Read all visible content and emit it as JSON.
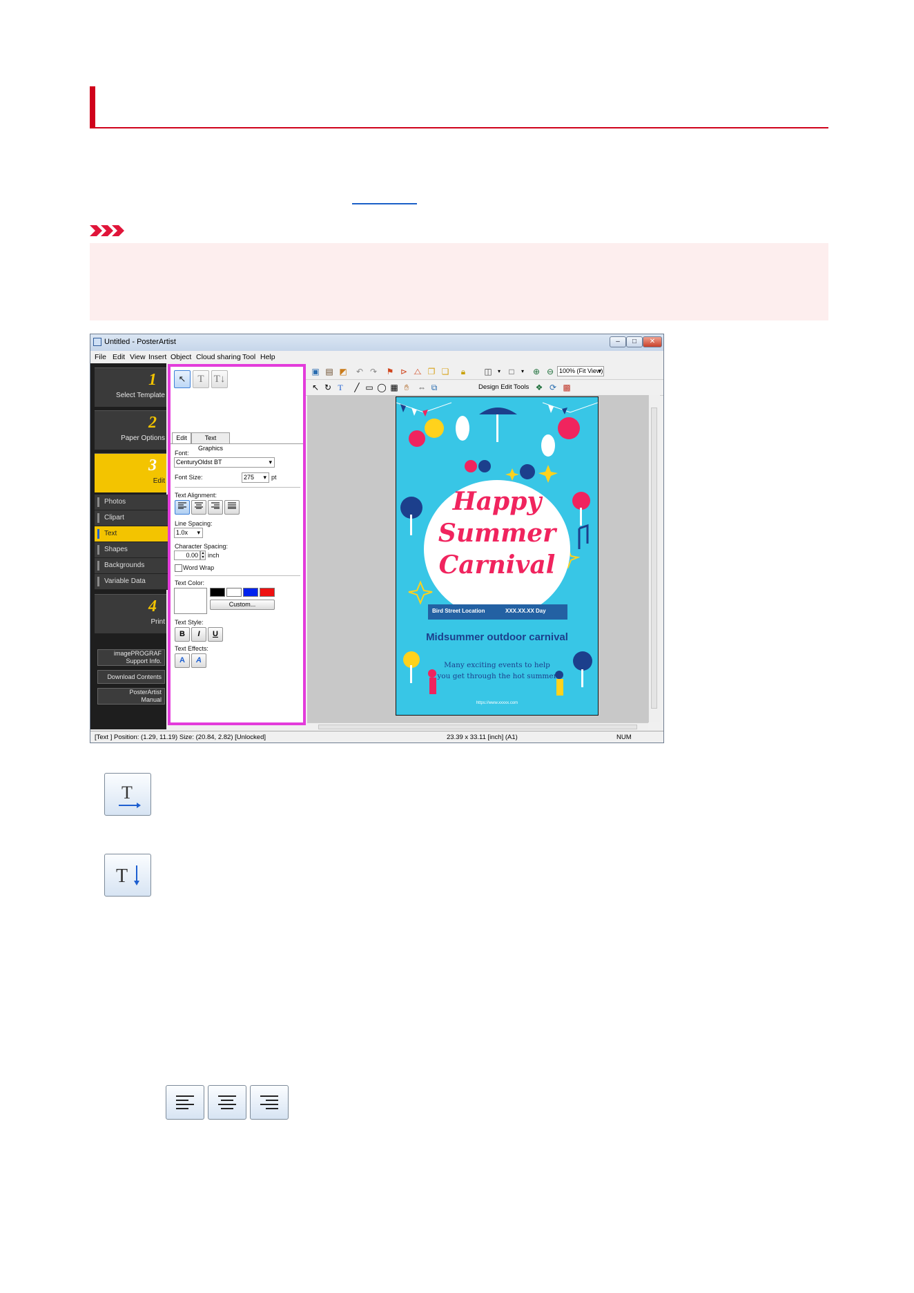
{
  "window": {
    "title": "Untitled - PosterArtist",
    "controls": [
      "–",
      "□",
      "✕"
    ]
  },
  "menu": [
    "File",
    "Edit",
    "View",
    "Insert",
    "Object",
    "Cloud sharing",
    "Tool",
    "Help"
  ],
  "steps": [
    {
      "num": "1",
      "label": "Select Template"
    },
    {
      "num": "2",
      "label": "Paper Options"
    },
    {
      "num": "3",
      "label": "Edit"
    },
    {
      "num": "4",
      "label": "Print"
    }
  ],
  "edit_sub_items": [
    "Photos",
    "Clipart",
    "Text",
    "Shapes",
    "Backgrounds",
    "Variable Data"
  ],
  "support_buttons": {
    "support_info_line1": "imagePROGRAF",
    "support_info_line2": "Support Info.",
    "download": "Download Contents",
    "manual_line1": "PosterArtist",
    "manual_line2": "Manual"
  },
  "panel": {
    "tab_edit": "Edit",
    "tab_graphics": "Text Graphics",
    "font_label": "Font:",
    "font_value": "CenturyOldst BT",
    "size_label": "Font Size:",
    "size_value": "275",
    "size_unit": "pt",
    "align_label": "Text Alignment:",
    "spacing_label": "Line Spacing:",
    "spacing_value": "1.0x",
    "char_label": "Character Spacing:",
    "char_value": "0.00",
    "char_unit": "inch",
    "wrap_label": "Word Wrap",
    "color_label": "Text Color:",
    "custom_button": "Custom...",
    "style_label": "Text Style:",
    "bold": "B",
    "italic": "I",
    "underline": "U",
    "effects_label": "Text Effects:",
    "swatch_colors": [
      "#000000",
      "#ffffff",
      "#0022ee",
      "#ee1111"
    ]
  },
  "toolbar": {
    "zoom_value": "100% (Fit View)",
    "design_edit_tools": "Design Edit Tools"
  },
  "poster": {
    "line1": "Happy",
    "line2": "Summer",
    "line3": "Carnival",
    "ribbon_left": "Bird Street Location",
    "ribbon_right": "XXX.XX.XX Day",
    "subtitle": "Midsummer outdoor carnival",
    "desc_line1": "Many exciting events to help",
    "desc_line2": "you get through the hot summer",
    "url": "https://www.xxxxx.com"
  },
  "status": {
    "left": "[Text ] Position: (1.29, 11.19) Size: (20.84, 2.82) [Unlocked]",
    "middle": "23.39 x 33.11 [inch] (A1)",
    "right": "NUM"
  },
  "colors": {
    "heading_accent": "#d0021b",
    "highlight_frame": "#e33cdb",
    "step_active": "#f3c400"
  }
}
